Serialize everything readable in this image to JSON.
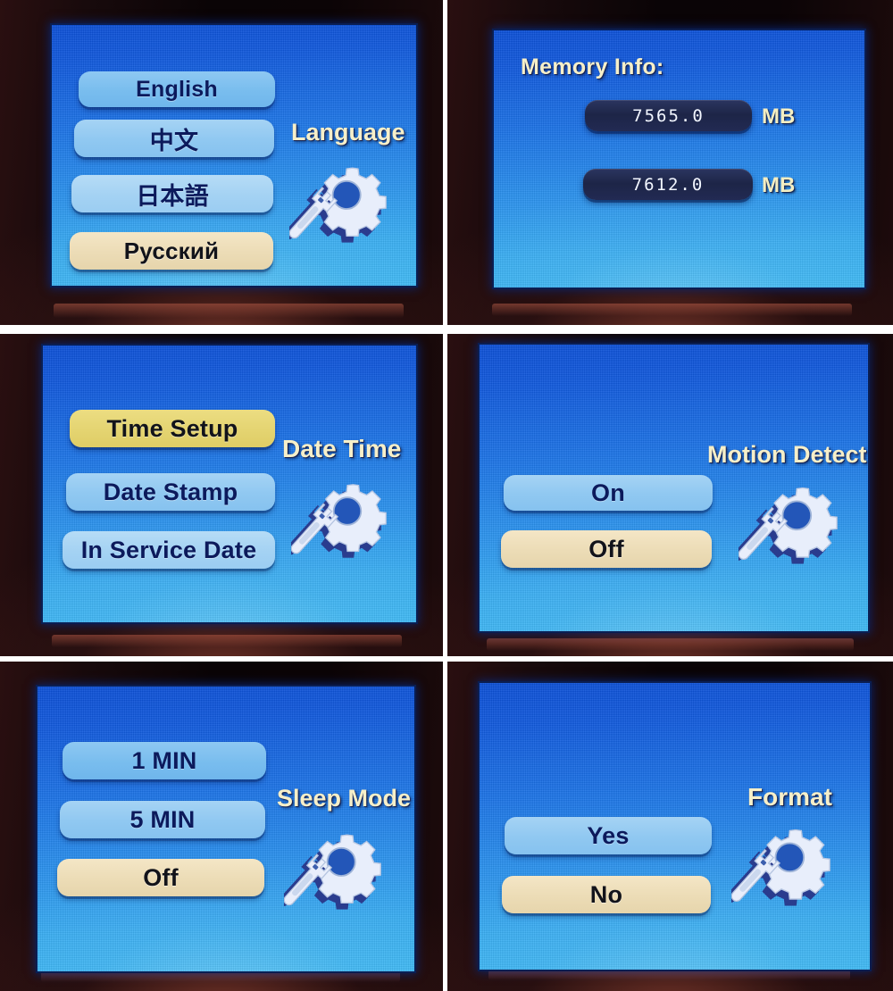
{
  "device": {
    "screen_type": "lcd-menu",
    "accent_title_color": "#f6efc9",
    "selected_cream_color": "#ecdcb6",
    "selected_yellow_color": "#e4d471",
    "button_blue_color": "#90c8f1",
    "screen_bg_top": "#0b4fd8",
    "screen_bg_bottom": "#3cbaf6",
    "bezel_color": "#180a0c"
  },
  "panels": [
    {
      "id": "language",
      "title": "Language",
      "icon": "gear-wrench-icon",
      "options": [
        {
          "label": "English",
          "selected": false
        },
        {
          "label": "中文",
          "selected": false
        },
        {
          "label": "日本語",
          "selected": false
        },
        {
          "label": "Русский",
          "selected": true
        }
      ]
    },
    {
      "id": "memory-info",
      "title": "Memory Info:",
      "fields": [
        {
          "value": "7565.0",
          "unit": "MB"
        },
        {
          "value": "7612.0",
          "unit": "MB"
        }
      ]
    },
    {
      "id": "date-time",
      "title": "Date Time",
      "icon": "gear-wrench-icon",
      "options": [
        {
          "label": "Time Setup",
          "selected": true
        },
        {
          "label": "Date Stamp",
          "selected": false
        },
        {
          "label": "In Service Date",
          "selected": false
        }
      ]
    },
    {
      "id": "motion-detect",
      "title": "Motion Detect",
      "icon": "gear-wrench-icon",
      "options": [
        {
          "label": "On",
          "selected": false
        },
        {
          "label": "Off",
          "selected": true
        }
      ]
    },
    {
      "id": "sleep-mode",
      "title": "Sleep Mode",
      "icon": "gear-wrench-icon",
      "options": [
        {
          "label": "1 MIN",
          "selected": false
        },
        {
          "label": "5 MIN",
          "selected": false
        },
        {
          "label": "Off",
          "selected": true
        }
      ]
    },
    {
      "id": "format",
      "title": "Format",
      "icon": "gear-wrench-icon",
      "options": [
        {
          "label": "Yes",
          "selected": false
        },
        {
          "label": "No",
          "selected": true
        }
      ]
    }
  ]
}
